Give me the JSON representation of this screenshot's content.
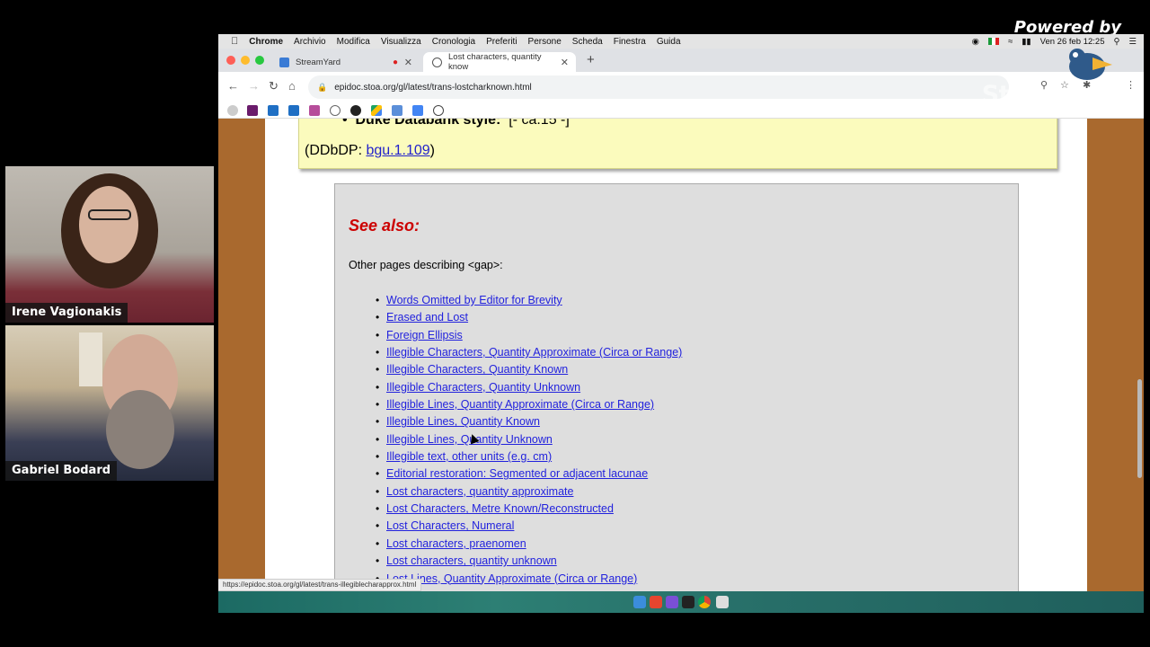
{
  "branding": {
    "powered_by": "Powered by",
    "logo_text": "StreamYard"
  },
  "participants": [
    {
      "name": "Irene Vagionakis"
    },
    {
      "name": "Gabriel Bodard"
    }
  ],
  "menubar": {
    "app": "Chrome",
    "items": [
      "Archivio",
      "Modifica",
      "Visualizza",
      "Cronologia",
      "Preferiti",
      "Persone",
      "Scheda",
      "Finestra",
      "Guida"
    ],
    "clock": "Ven 26 feb 12:25"
  },
  "tabs": [
    {
      "title": "StreamYard",
      "recording": true
    },
    {
      "title": "Lost characters, quantity know"
    }
  ],
  "address_bar": {
    "url": "epidoc.stoa.org/gl/latest/trans-lostcharknown.html"
  },
  "page": {
    "duke_label": "Duke Databank style:",
    "duke_value": "[- ca.15 -]",
    "ddbdp_prefix": "(DDbDP: ",
    "ddbdp_link": "bgu.1.109",
    "ddbdp_suffix": ")",
    "see_also_title": "See also:",
    "see_also_desc": "Other pages describing <gap>:",
    "see_also_links": [
      "Words Omitted by Editor for Brevity",
      "Erased and Lost",
      "Foreign Ellipsis",
      "Illegible Characters, Quantity Approximate (Circa or Range)",
      "Illegible Characters, Quantity Known",
      "Illegible Characters, Quantity Unknown",
      "Illegible Lines, Quantity Approximate (Circa or Range)",
      "Illegible Lines, Quantity Known",
      "Illegible Lines, Quantity Unknown",
      "Illegible text, other units (e.g. cm)",
      "Editorial restoration: Segmented or adjacent lacunae",
      "Lost characters, quantity approximate",
      "Lost Characters, Metre Known/Reconstructed",
      "Lost Characters, Numeral",
      "Lost characters, praenomen",
      "Lost characters, quantity unknown",
      "Lost Lines, Quantity Approximate (Circa or Range)"
    ]
  },
  "status_url": "https://epidoc.stoa.org/gl/latest/trans-illegiblecharapprox.html",
  "colors": {
    "see_also_title": "#cc0000",
    "link": "#2222dd",
    "yellow_box": "#fbfbbd",
    "page_sidebar": "#a9692e"
  }
}
